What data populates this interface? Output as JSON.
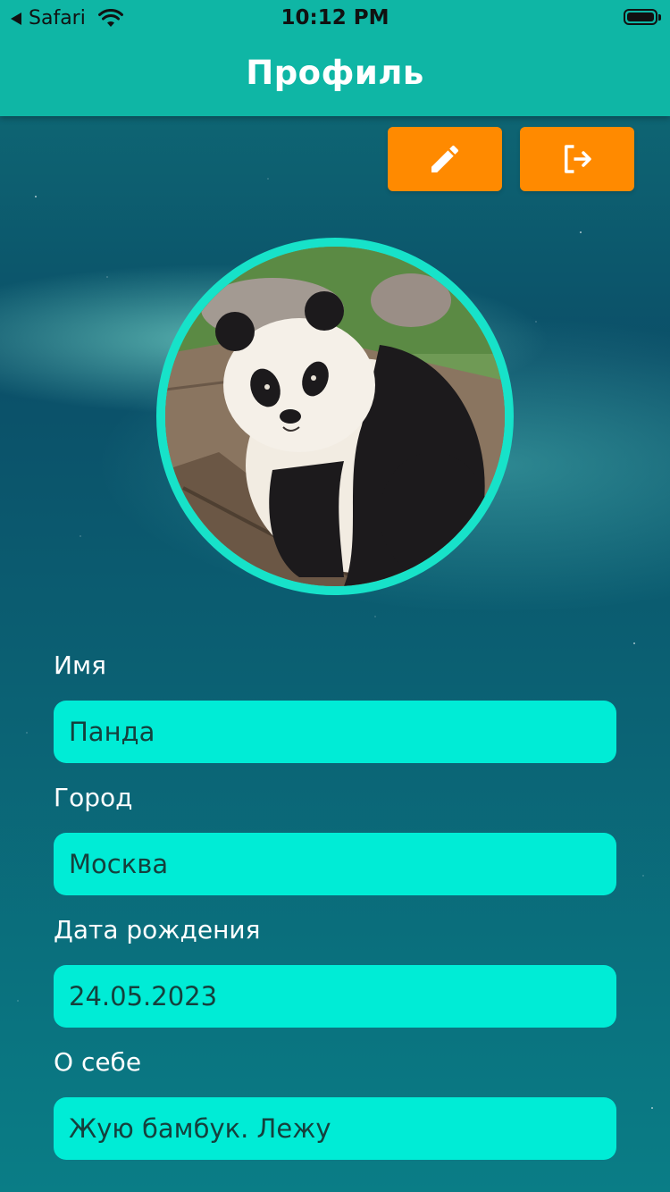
{
  "status_bar": {
    "back_app": "Safari",
    "time": "10:12 PM",
    "battery_level": 1.0
  },
  "header": {
    "title": "Профиль"
  },
  "actions": {
    "edit_icon": "pencil-icon",
    "logout_icon": "logout-icon"
  },
  "avatar": {
    "description_icon": "panda-photo"
  },
  "form": {
    "fields": [
      {
        "label": "Имя",
        "value": "Панда"
      },
      {
        "label": "Город",
        "value": "Москва"
      },
      {
        "label": "Дата рождения",
        "value": "24.05.2023"
      },
      {
        "label": "О себе",
        "value": "Жую бамбук. Лежу"
      }
    ]
  },
  "colors": {
    "header": "#0fb6a5",
    "action_button": "#ff8a00",
    "input_background": "#00ecd6",
    "avatar_border": "#17e2c9"
  }
}
